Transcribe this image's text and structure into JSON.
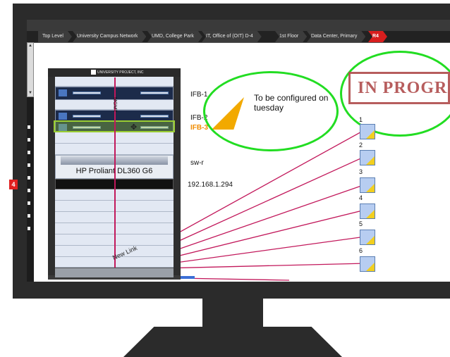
{
  "breadcrumb": [
    {
      "label": "Top Level"
    },
    {
      "label": "University Campus Network"
    },
    {
      "label": "UMD, College Park"
    },
    {
      "label": "IT, Office of (OIT) D-4"
    },
    {
      "label": "1st Floor"
    },
    {
      "label": "Data Center, Primary"
    },
    {
      "label": "R4"
    }
  ],
  "rack": {
    "logo_text": "UNIVERSITY PROJECT, INC",
    "vertical_label": "MGMT",
    "server_label": "HP Proliant DL360 G6"
  },
  "device_labels": {
    "ifb1": "IFB-1",
    "ifb2": "IFB-2",
    "ifb3": "IFB-3",
    "swr": "sw-r",
    "ip": "192.168.1.294"
  },
  "annotation": {
    "note": "To be configured on tuesday",
    "stamp": "IN PROGRESS"
  },
  "new_link_label": "New Link",
  "sidebar": {
    "badge": "4"
  },
  "ports": [
    {
      "label": "1"
    },
    {
      "label": "2"
    },
    {
      "label": "3"
    },
    {
      "label": "4"
    },
    {
      "label": "5"
    },
    {
      "label": "6"
    }
  ],
  "colors": {
    "link": "#c2185b",
    "annotation_green": "#22dd22",
    "highlight": "#f08c00",
    "breadcrumb_active": "#d81e1e"
  }
}
